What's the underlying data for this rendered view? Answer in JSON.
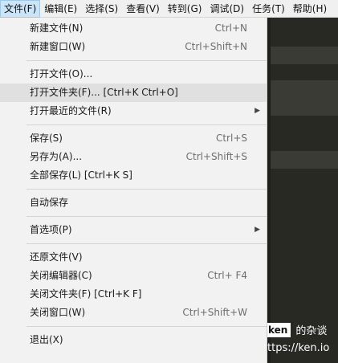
{
  "menubar": {
    "items": [
      {
        "label": "文件(F)",
        "active": true
      },
      {
        "label": "编辑(E)"
      },
      {
        "label": "选择(S)"
      },
      {
        "label": "查看(V)"
      },
      {
        "label": "转到(G)"
      },
      {
        "label": "调试(D)"
      },
      {
        "label": "任务(T)"
      },
      {
        "label": "帮助(H)"
      }
    ]
  },
  "file_menu": {
    "new_file": {
      "label": "新建文件(N)",
      "shortcut": "Ctrl+N"
    },
    "new_window": {
      "label": "新建窗口(W)",
      "shortcut": "Ctrl+Shift+N"
    },
    "open_file": {
      "label": "打开文件(O)..."
    },
    "open_folder": {
      "label": "打开文件夹(F)... [Ctrl+K Ctrl+O]"
    },
    "open_recent": {
      "label": "打开最近的文件(R)"
    },
    "save": {
      "label": "保存(S)",
      "shortcut": "Ctrl+S"
    },
    "save_as": {
      "label": "另存为(A)...",
      "shortcut": "Ctrl+Shift+S"
    },
    "save_all": {
      "label": "全部保存(L) [Ctrl+K S]"
    },
    "auto_save": {
      "label": "自动保存"
    },
    "preferences": {
      "label": "首选项(P)"
    },
    "revert_file": {
      "label": "还原文件(V)"
    },
    "close_editor": {
      "label": "关闭编辑器(C)",
      "shortcut": "Ctrl+ F4"
    },
    "close_folder": {
      "label": "关闭文件夹(F) [Ctrl+K F]"
    },
    "close_window": {
      "label": "关闭窗口(W)",
      "shortcut": "Ctrl+Shift+W"
    },
    "exit": {
      "label": "退出(X)"
    }
  },
  "watermark": {
    "badge": "ken",
    "text": "的杂谈",
    "url": "ttps://ken.io"
  },
  "colors": {
    "menubar_bg": "#f0f0f0",
    "menu_bg": "#f2f2f2",
    "highlight_bg": "#e0e0e0",
    "active_menubar_bg": "#cce4f7",
    "editor_bg": "#282923"
  }
}
